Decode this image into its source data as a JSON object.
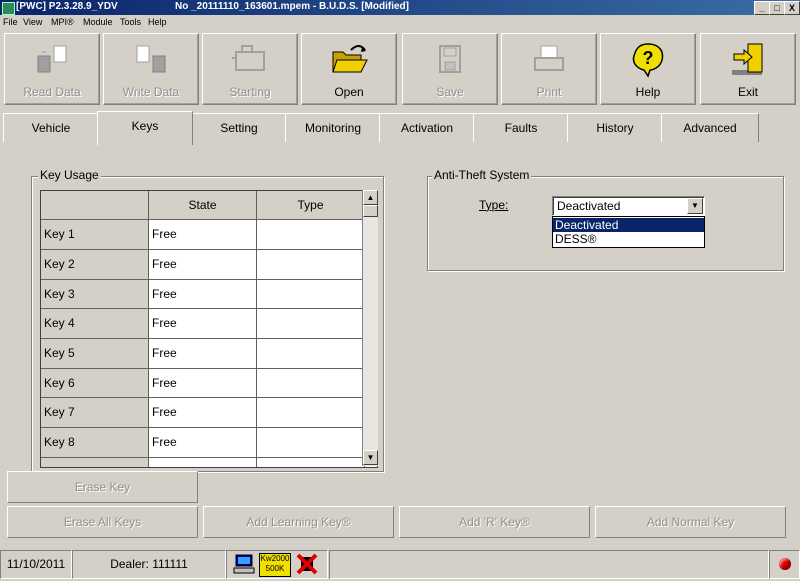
{
  "window": {
    "app_tag": "[PWC] P2.3.28.9_YDV",
    "doc_title": "No _20111110_163601.mpem - B.U.D.S. [Modified]",
    "controls": [
      "_",
      "□",
      "X"
    ]
  },
  "menu": [
    "File",
    "View",
    "MPI®",
    "Module",
    "Tools",
    "Help"
  ],
  "toolbar": [
    {
      "label": "Read Data",
      "icon": "read-data-icon",
      "enabled": false
    },
    {
      "label": "Write Data",
      "icon": "write-data-icon",
      "enabled": false
    },
    {
      "label": "Starting",
      "icon": "engine-icon",
      "enabled": false
    },
    {
      "label": "Open",
      "icon": "open-folder-icon",
      "enabled": true
    },
    {
      "label": "Save",
      "icon": "floppy-disk-icon",
      "enabled": false
    },
    {
      "label": "Print",
      "icon": "printer-icon",
      "enabled": false
    },
    {
      "label": "Help",
      "icon": "help-question-icon",
      "enabled": true
    },
    {
      "label": "Exit",
      "icon": "exit-door-icon",
      "enabled": true
    }
  ],
  "tabs": [
    "Vehicle",
    "Keys",
    "Setting",
    "Monitoring",
    "Activation",
    "Faults",
    "History",
    "Advanced"
  ],
  "active_tab": "Keys",
  "key_usage": {
    "title": "Key Usage",
    "columns": [
      "",
      "State",
      "Type"
    ],
    "rows": [
      {
        "key": "Key 1",
        "state": "Free",
        "type": ""
      },
      {
        "key": "Key 2",
        "state": "Free",
        "type": ""
      },
      {
        "key": "Key 3",
        "state": "Free",
        "type": ""
      },
      {
        "key": "Key 4",
        "state": "Free",
        "type": ""
      },
      {
        "key": "Key 5",
        "state": "Free",
        "type": ""
      },
      {
        "key": "Key 6",
        "state": "Free",
        "type": ""
      },
      {
        "key": "Key 7",
        "state": "Free",
        "type": ""
      },
      {
        "key": "Key 8",
        "state": "Free",
        "type": ""
      }
    ]
  },
  "anti_theft": {
    "title": "Anti-Theft System",
    "type_label": "Type:",
    "selected": "Deactivated",
    "options": [
      "Deactivated",
      "DESS®"
    ]
  },
  "buttons": {
    "erase_key": "Erase Key",
    "erase_all_keys": "Erase All Keys",
    "add_learning_key": "Add Learning Key®",
    "add_r_key": "Add 'R' Key®",
    "add_normal_key": "Add Normal Key"
  },
  "status": {
    "date": "11/10/2011",
    "dealer": "Dealer: 111111",
    "baud_badge": [
      "Kw2000",
      "500K"
    ],
    "indicator_color": "#e00000"
  },
  "colors": {
    "titlebar": "#0a246a",
    "face": "#d4d0c8",
    "selection": "#0a246a",
    "folder_yellow": "#f0d000"
  }
}
